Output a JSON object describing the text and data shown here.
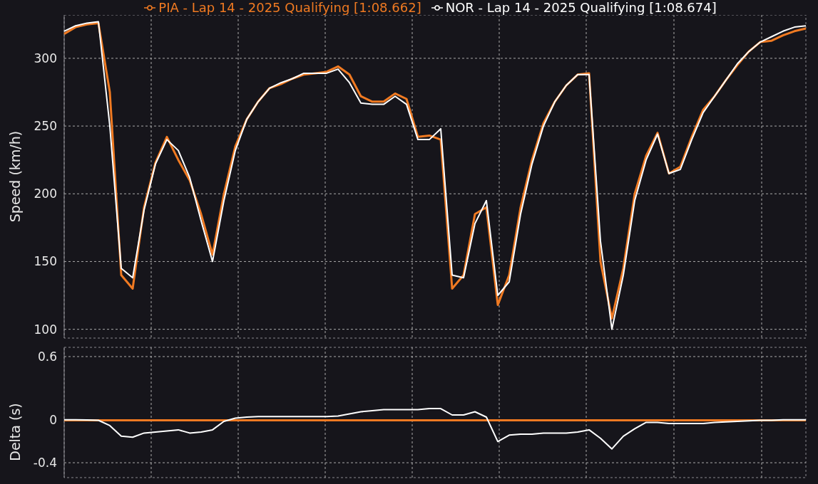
{
  "speed_chart": {
    "chart_data": {
      "type": "line",
      "ylabel": "Speed (km/h)",
      "ylim": [
        93.5,
        332
      ],
      "yticks": [
        100,
        150,
        200,
        250,
        300
      ],
      "grid": true,
      "series": [
        {
          "name": "PIA - Lap 14 - 2025 Qualifying [1:08.662]",
          "color": "#f07a22",
          "values": [
            318,
            323,
            325,
            326,
            275,
            140,
            130,
            190,
            223,
            242,
            225,
            210,
            185,
            155,
            200,
            235,
            255,
            268,
            278,
            281,
            285,
            288,
            289,
            290,
            294,
            288,
            272,
            268,
            268,
            274,
            270,
            242,
            243,
            240,
            130,
            140,
            185,
            190,
            118,
            140,
            190,
            225,
            252,
            268,
            280,
            288,
            289,
            150,
            108,
            145,
            200,
            228,
            245,
            215,
            220,
            242,
            262,
            272,
            284,
            295,
            305,
            312,
            313,
            317,
            320,
            322
          ]
        },
        {
          "name": "NOR - Lap 14 - 2025 Qualifying [1:08.674]",
          "color": "#ffffff",
          "values": [
            320,
            324,
            326,
            327,
            250,
            145,
            138,
            188,
            222,
            240,
            232,
            212,
            180,
            150,
            195,
            232,
            255,
            268,
            278,
            282,
            285,
            289,
            289,
            289,
            292,
            282,
            267,
            266,
            266,
            272,
            266,
            240,
            240,
            248,
            140,
            138,
            178,
            195,
            125,
            135,
            185,
            222,
            250,
            268,
            280,
            288,
            288,
            165,
            100,
            140,
            195,
            225,
            244,
            215,
            218,
            240,
            260,
            272,
            284,
            296,
            305,
            312,
            316,
            320,
            323,
            324
          ]
        }
      ]
    }
  },
  "delta_chart": {
    "chart_data": {
      "type": "line",
      "ylabel": "Delta (s)",
      "ylim": [
        -0.54,
        0.687
      ],
      "yticks": [
        -0.4,
        0,
        0.6
      ],
      "grid": true,
      "series": [
        {
          "color": "#f07a22",
          "values": [
            0,
            0,
            0,
            0,
            0,
            0,
            0,
            0,
            0,
            0,
            0,
            0,
            0,
            0,
            0,
            0,
            0,
            0,
            0,
            0,
            0,
            0,
            0,
            0,
            0,
            0,
            0,
            0,
            0,
            0,
            0,
            0,
            0,
            0,
            0,
            0,
            0,
            0,
            0,
            0,
            0,
            0,
            0,
            0,
            0,
            0,
            0,
            0,
            0,
            0,
            0,
            0,
            0,
            0,
            0,
            0,
            0,
            0,
            0,
            0,
            0,
            0,
            0,
            0,
            0,
            0
          ]
        },
        {
          "color": "#ffffff",
          "values": [
            0.005,
            0.005,
            0.003,
            0,
            -0.05,
            -0.15,
            -0.16,
            -0.12,
            -0.11,
            -0.1,
            -0.09,
            -0.12,
            -0.11,
            -0.09,
            -0.01,
            0.02,
            0.03,
            0.035,
            0.035,
            0.035,
            0.035,
            0.035,
            0.035,
            0.035,
            0.04,
            0.06,
            0.08,
            0.09,
            0.1,
            0.1,
            0.1,
            0.1,
            0.11,
            0.11,
            0.05,
            0.05,
            0.08,
            0.03,
            -0.2,
            -0.14,
            -0.13,
            -0.13,
            -0.12,
            -0.12,
            -0.12,
            -0.11,
            -0.09,
            -0.17,
            -0.27,
            -0.15,
            -0.08,
            -0.02,
            -0.02,
            -0.03,
            -0.03,
            -0.03,
            -0.03,
            -0.02,
            -0.015,
            -0.01,
            -0.005,
            0,
            0,
            0.005,
            0.005,
            0.005
          ]
        }
      ]
    }
  }
}
